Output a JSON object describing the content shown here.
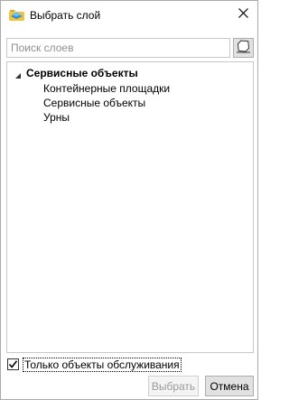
{
  "window": {
    "title": "Выбрать слой",
    "icon": "layers-icon"
  },
  "search": {
    "placeholder": "Поиск слоев",
    "value": "",
    "clear_icon": "eraser-icon"
  },
  "tree": {
    "root": {
      "label": "Сервисные объекты",
      "expanded": true,
      "children": [
        {
          "label": "Контейнерные площадки"
        },
        {
          "label": "Сервисные объекты"
        },
        {
          "label": "Урны"
        }
      ]
    }
  },
  "filter": {
    "checkbox_label": "Только объекты обслуживания",
    "checked": true
  },
  "buttons": {
    "select_label": "Выбрать",
    "select_enabled": false,
    "cancel_label": "Отмена"
  },
  "colors": {
    "border": "#c7c7c7",
    "button_bg": "#e1e1e1",
    "disabled_text": "#9a9a9a",
    "icon_yellow": "#f2c43a",
    "icon_blue": "#2b8fd6"
  }
}
